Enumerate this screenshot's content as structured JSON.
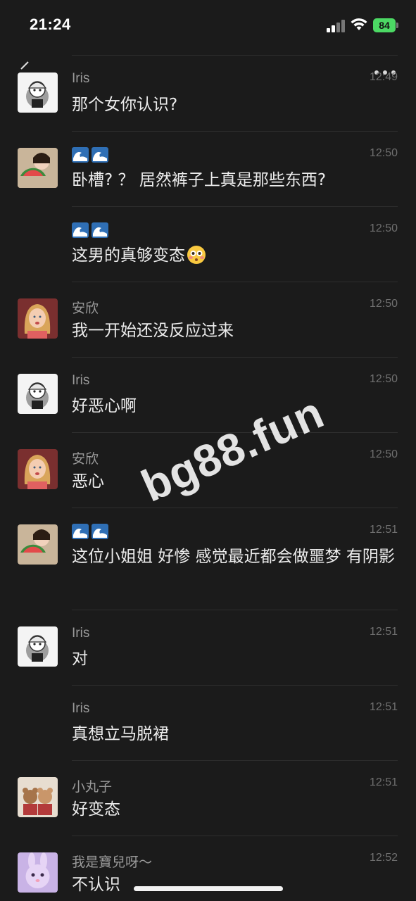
{
  "status_bar": {
    "time": "21:24",
    "battery": "84"
  },
  "messages": [
    {
      "name": "Iris",
      "time": "12:49",
      "text": "那个女你认识?",
      "avatar": "iris"
    },
    {
      "name": "",
      "name_icon": "wave-emoji",
      "time": "12:50",
      "text": "卧槽? ？ 居然裤子上真是那些东西?",
      "avatar": "watermelon-girl"
    },
    {
      "name": "",
      "name_icon": "wave-emoji",
      "time": "12:50",
      "text": "这男的真够变态",
      "emoji": "flushed-emoji",
      "avatar": ""
    },
    {
      "name": "安欣",
      "time": "12:50",
      "text": "我一开始还没反应过来",
      "avatar": "blonde-girl"
    },
    {
      "name": "Iris",
      "time": "12:50",
      "text": "好恶心啊",
      "avatar": "iris"
    },
    {
      "name": "安欣",
      "time": "12:50",
      "text": "恶心",
      "avatar": "blonde-girl"
    },
    {
      "name": "",
      "name_icon": "wave-emoji",
      "time": "12:51",
      "text": "这位小姐姐 好惨 感觉最近都会做噩梦 有阴影",
      "avatar": "watermelon-girl"
    },
    {
      "name": "Iris",
      "time": "12:51",
      "text": "对",
      "avatar": "iris"
    },
    {
      "name": "Iris",
      "time": "12:51",
      "text": "真想立马脱裙",
      "avatar": ""
    },
    {
      "name": "小丸子",
      "time": "12:51",
      "text": "好变态",
      "avatar": "teddy-bears"
    },
    {
      "name": "我是寶兒呀～",
      "time": "12:52",
      "text": "不认识",
      "avatar": "purple-bunny"
    }
  ],
  "watermark": "bg88.fun",
  "colors": {
    "background": "#1b1b1b",
    "battery": "#4cd964"
  }
}
